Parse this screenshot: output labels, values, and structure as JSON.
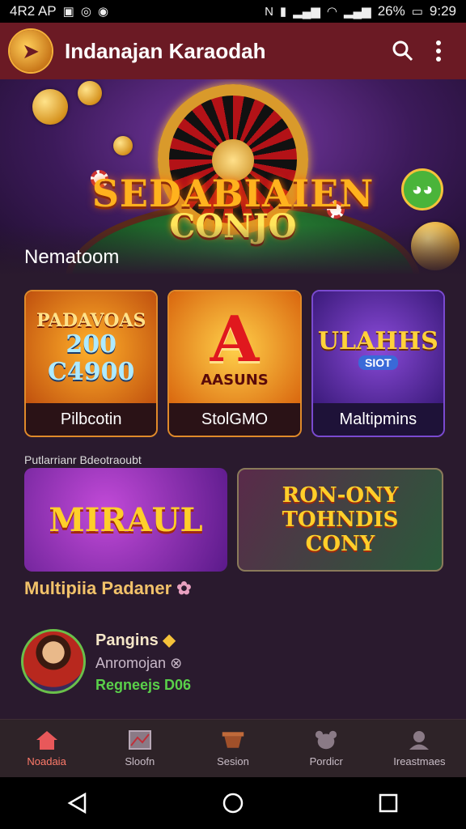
{
  "status_bar": {
    "left_text": "4R2 AP",
    "time": "9:29",
    "battery": "26%"
  },
  "app_bar": {
    "title": "Indanajan Karaodah",
    "icons": [
      "back-logo-icon",
      "search-icon",
      "more-vert-icon"
    ]
  },
  "hero": {
    "title": "SEDABIAIEN",
    "subtitle": "CONJO",
    "section_label": "Nematoom"
  },
  "tiles": [
    {
      "art_line1": "PADAVOAS",
      "art_line2": "200",
      "art_line3": "C4900",
      "label": "Pilbcotin"
    },
    {
      "art_big": "A",
      "art_small": "AASUNS",
      "label": "StolGMO"
    },
    {
      "art_main": "ULAHHS",
      "art_sub": "SIOT",
      "label": "Maltipmins"
    }
  ],
  "featured": {
    "caption": "Putlarrianr Bdeotraoubt",
    "items": [
      {
        "title": "MIRAUL"
      },
      {
        "title_lines": [
          "RON-ONY",
          "TOHNDIS",
          "CONY"
        ]
      }
    ],
    "label": "Multipiia Padaner"
  },
  "profile": {
    "name": "Pangins",
    "username": "Anromojan",
    "status": "Regneejs D06"
  },
  "bottom_nav": [
    {
      "label": "Noadaia",
      "icon": "home-icon",
      "active": true
    },
    {
      "label": "Sloofn",
      "icon": "gallery-icon",
      "active": false
    },
    {
      "label": "Sesion",
      "icon": "bowl-icon",
      "active": false
    },
    {
      "label": "Pordicr",
      "icon": "bear-icon",
      "active": false
    },
    {
      "label": "Ireastmaes",
      "icon": "profile-icon",
      "active": false
    }
  ],
  "colors": {
    "app_bar": "#6b1a24",
    "background": "#2a1a2e",
    "active_nav": "#e8585a",
    "accent_gold": "#ffb21e"
  }
}
